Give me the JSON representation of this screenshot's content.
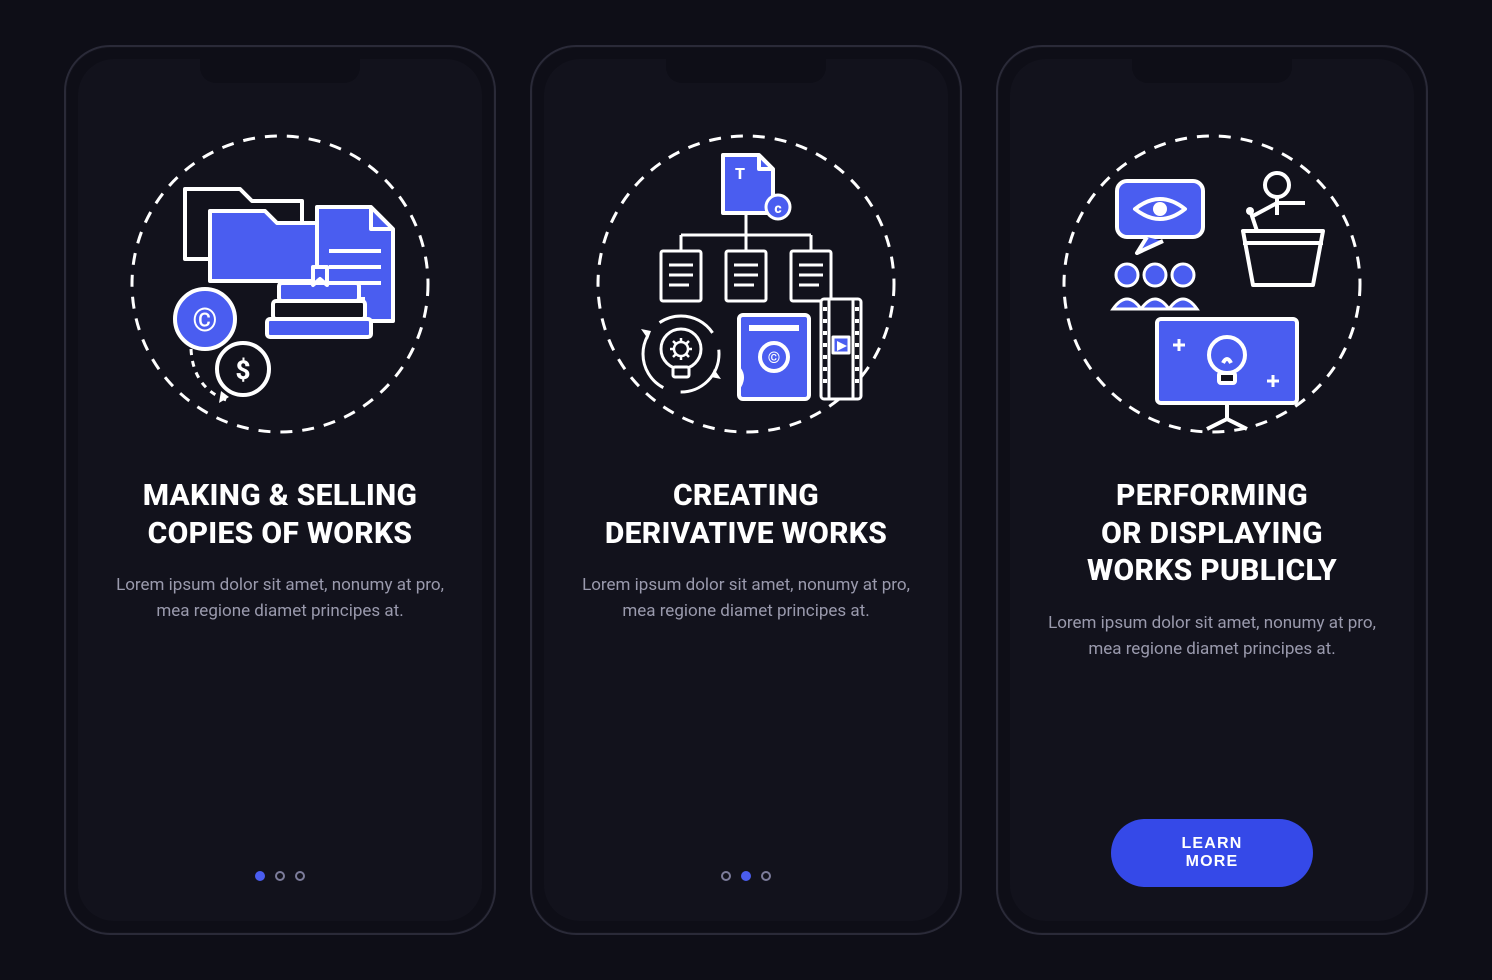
{
  "accent": "#4a5df0",
  "accent_dark": "#3549e8",
  "screens": [
    {
      "id": "making-selling",
      "title": "Making & Selling\nCopies Of Works",
      "body": "Lorem ipsum dolor sit amet, nonumy at pro, mea regione diamet principes at.",
      "icon": "folders-books-icon",
      "active_dot": 0,
      "has_cta": false
    },
    {
      "id": "derivative-works",
      "title": "Creating\nDerivative Works",
      "body": "Lorem ipsum dolor sit amet, nonumy at pro, mea regione diamet principes at.",
      "icon": "derivative-tree-icon",
      "active_dot": 1,
      "has_cta": false
    },
    {
      "id": "performing-displaying",
      "title": "Performing\nOr Displaying\nWorks Publicly",
      "body": "Lorem ipsum dolor sit amet, nonumy at pro, mea regione diamet principes at.",
      "icon": "public-display-icon",
      "active_dot": 2,
      "has_cta": true
    }
  ],
  "cta_label": "LEARN MORE"
}
